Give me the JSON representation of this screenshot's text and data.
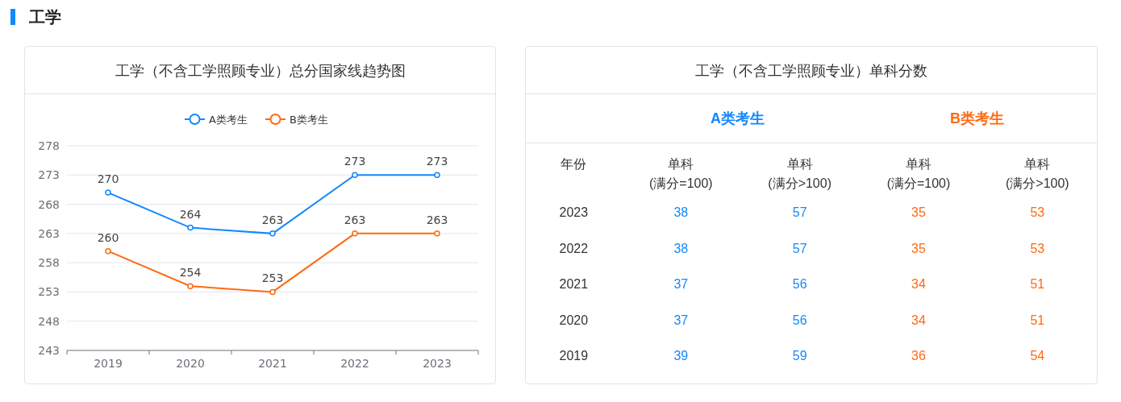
{
  "section_title": "工学",
  "trend_card": {
    "title": "工学（不含工学照顾专业）总分国家线趋势图",
    "chart_data": {
      "type": "line",
      "categories": [
        "2019",
        "2020",
        "2021",
        "2022",
        "2023"
      ],
      "ylim": [
        243,
        278
      ],
      "yticks": [
        243,
        248,
        253,
        258,
        263,
        268,
        273,
        278
      ],
      "data_labels": true,
      "grid": true,
      "legend": "top",
      "series": [
        {
          "name": "A类考生",
          "color": "#1488fd",
          "marker": "circle",
          "values": [
            270,
            264,
            263,
            273,
            273
          ]
        },
        {
          "name": "B类考生",
          "color": "#ff6a12",
          "marker": "circle",
          "values": [
            260,
            254,
            253,
            263,
            263
          ]
        }
      ]
    }
  },
  "score_card": {
    "title": "工学（不含工学照顾专业）单科分数",
    "groups": [
      {
        "name": "A类考生",
        "color": "#1488fd"
      },
      {
        "name": "B类考生",
        "color": "#ff6a12"
      }
    ],
    "columns": [
      {
        "label": "年份"
      },
      {
        "label": "单科",
        "sub": "(满分=100)"
      },
      {
        "label": "单科",
        "sub": "(满分>100)"
      },
      {
        "label": "单科",
        "sub": "(满分=100)"
      },
      {
        "label": "单科",
        "sub": "(满分>100)"
      }
    ],
    "rows": [
      {
        "year": "2023",
        "values": [
          "38",
          "57",
          "35",
          "53"
        ]
      },
      {
        "year": "2022",
        "values": [
          "38",
          "57",
          "35",
          "53"
        ]
      },
      {
        "year": "2021",
        "values": [
          "37",
          "56",
          "34",
          "51"
        ]
      },
      {
        "year": "2020",
        "values": [
          "37",
          "56",
          "34",
          "51"
        ]
      },
      {
        "year": "2019",
        "values": [
          "39",
          "59",
          "36",
          "54"
        ]
      }
    ]
  }
}
